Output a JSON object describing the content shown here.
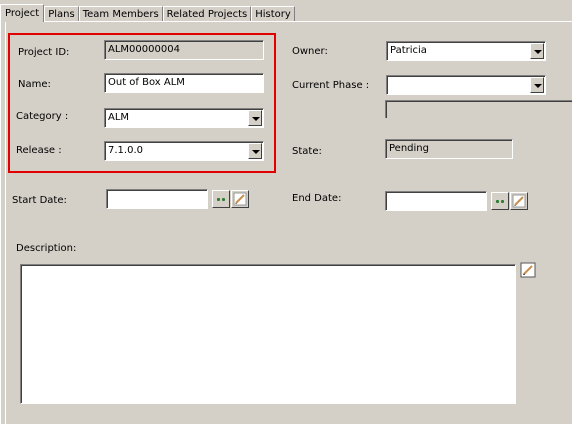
{
  "tabs": [
    {
      "label": "Project",
      "active": true
    },
    {
      "label": "Plans"
    },
    {
      "label": "Team Members"
    },
    {
      "label": "Related Projects"
    },
    {
      "label": "History"
    }
  ],
  "form": {
    "project_id_label": "Project ID:",
    "project_id_value": "ALM00000004",
    "name_label": "Name:",
    "name_value": "Out of Box ALM",
    "category_label": "Category :",
    "category_value": "ALM",
    "release_label": "Release :",
    "release_value": "7.1.0.0",
    "owner_label": "Owner:",
    "owner_value": "Patricia",
    "current_phase_label": "Current Phase :",
    "current_phase_value": "",
    "state_label": "State:",
    "state_value": "Pending",
    "start_date_label": "Start Date:",
    "start_date_value": "",
    "end_date_label": "End Date:",
    "end_date_value": "",
    "description_label": "Description:",
    "description_value": ""
  },
  "colors": {
    "highlight": "#e00000",
    "dialog_bg": "#d4d0c8"
  },
  "icons": {
    "date_picker": "dots-icon",
    "clear": "edit-icon"
  }
}
